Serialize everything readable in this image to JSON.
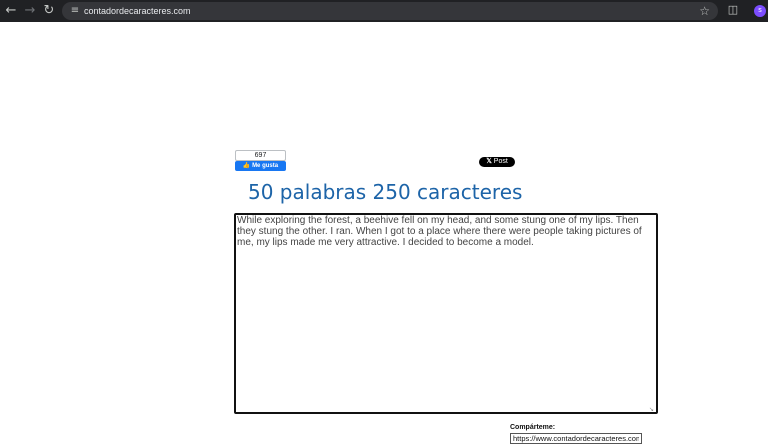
{
  "browser": {
    "url": "contadordecaracteres.com",
    "profile_initial": "s",
    "icons": {
      "back": "arrow-left-icon",
      "forward": "arrow-right-icon",
      "reload": "reload-icon",
      "site_info": "tune-icon",
      "bookmark": "star-icon",
      "extensions": "puzzle-icon"
    }
  },
  "social": {
    "fb_count": "697",
    "fb_button_label": "Me gusta",
    "x_button_label": "Post",
    "colors": {
      "facebook": "#1877f2",
      "x": "#000000"
    }
  },
  "main": {
    "title": "50 palabras 250 caracteres",
    "text": "While exploring the forest, a beehive fell on my head, and some stung one of my lips. Then they stung the other. I ran. When I got to a place where there were people taking pictures of me, my lips made me very attractive. I decided to become a model.",
    "title_color": "#1d64a8"
  },
  "share": {
    "label": "Compárteme:",
    "url": "https://www.contadordecaracteres.com"
  }
}
